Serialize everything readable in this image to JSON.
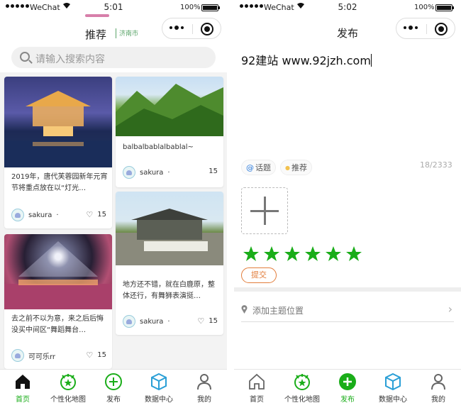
{
  "status_left": {
    "carrier": "WeChat",
    "time": "5:01",
    "battery": "100%"
  },
  "status_right": {
    "carrier": "WeChat",
    "time": "5:02",
    "battery": "100%"
  },
  "home": {
    "nav_title": "推荐",
    "city": "济南市",
    "search_placeholder": "请输入搜索内容",
    "cards": [
      {
        "desc": "2019年，唐代芙蓉园新年元宵节将重点放在以“灯光…",
        "user": "sakura",
        "likes": "15"
      },
      {
        "desc": "balbalbablalbablal~",
        "user": "sakura",
        "likes": "15"
      },
      {
        "desc": "去之前不以为意，来之后后悔没买中间区“舞蹈舞台…",
        "user": "可可乐rr",
        "likes": "15"
      },
      {
        "desc": "地方还不错，就在白鹿原，整体还行，有舞狮表演挺…",
        "user": "sakura",
        "likes": "15"
      }
    ]
  },
  "publish": {
    "nav_title": "发布",
    "content": "92建站 www.92jzh.com",
    "chip_topic": "话题",
    "chip_recommend": "推荐",
    "counter": "18/2333",
    "rating_stars": 6,
    "submit_label": "提交",
    "location_label": "添加主题位置"
  },
  "tabs": [
    "首页",
    "个性化地图",
    "发布",
    "数据中心",
    "我的"
  ],
  "colors": {
    "accent_green": "#1aad19",
    "submit_orange": "#e27d3b",
    "tab_highlight": "#d77faa"
  }
}
